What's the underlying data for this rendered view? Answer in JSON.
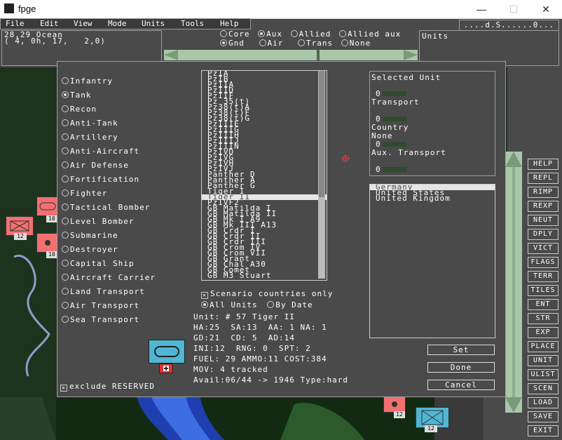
{
  "window": {
    "title": "fpge",
    "min": "—",
    "max": "☐",
    "close": "✕"
  },
  "menu": [
    "File",
    "Edit",
    "View",
    "Mode",
    "Units",
    "Tools",
    "Help"
  ],
  "status_right": "....d.S......0...",
  "hex_info": {
    "line1": "28,29 Ocean",
    "line2": "( 4, 0h, 17,   2,0)"
  },
  "filters_row1": [
    {
      "label": "Core",
      "checked": false
    },
    {
      "label": "Aux",
      "checked": true
    },
    {
      "label": "Allied",
      "checked": false
    },
    {
      "label": "Allied aux",
      "checked": false
    }
  ],
  "filters_row2": [
    {
      "label": "Gnd",
      "checked": true
    },
    {
      "label": "Air",
      "checked": false
    },
    {
      "label": "Trans",
      "checked": false
    },
    {
      "label": "None",
      "checked": false
    }
  ],
  "units_panel_label": "Units",
  "unit_types": [
    {
      "label": "Infantry",
      "selected": false
    },
    {
      "label": "Tank",
      "selected": true
    },
    {
      "label": "Recon",
      "selected": false
    },
    {
      "label": "Anti-Tank",
      "selected": false
    },
    {
      "label": "Artillery",
      "selected": false
    },
    {
      "label": "Anti-Aircraft",
      "selected": false
    },
    {
      "label": "Air Defense",
      "selected": false
    },
    {
      "label": "Fortification",
      "selected": false
    },
    {
      "label": "Fighter",
      "selected": false
    },
    {
      "label": "Tactical Bomber",
      "selected": false
    },
    {
      "label": "Level Bomber",
      "selected": false
    },
    {
      "label": "Submarine",
      "selected": false
    },
    {
      "label": "Destroyer",
      "selected": false
    },
    {
      "label": "Capital Ship",
      "selected": false
    },
    {
      "label": "Aircraft Carrier",
      "selected": false
    },
    {
      "label": "Land Transport",
      "selected": false
    },
    {
      "label": "Air Transport",
      "selected": false
    },
    {
      "label": "Sea Transport",
      "selected": false
    }
  ],
  "unit_list": [
    "PzIA",
    "PzIB",
    "PzIIA",
    "PzIID",
    "PzIIF",
    "Pz 35(t)",
    "Pz38(t)A",
    "Pz38(t)F",
    "Pz38(t)G",
    "PzIIIE",
    "PzIIIG",
    "PzIIIH",
    "PzIIIJ",
    "PzIIIN",
    "PzIVD",
    "PzIVG",
    "PzIVH",
    "PzIVJ",
    "Panther D",
    "Panther A",
    "Panther G",
    "Tiger I",
    "Tiger II",
    "PzIVF2",
    "GB Matilda I",
    "GB Matilda II",
    "GB Mk I A9",
    "GB Mk III A13",
    "GB Crdr I",
    "GB Crdr II",
    "GB Crdr III",
    "GB Crom IV",
    "GB Crom VII",
    "GB Grant",
    "GB Chal A30",
    "GB Comet",
    "GB M3 Stuart"
  ],
  "unit_list_selected": 22,
  "scenario_only": {
    "label": "Scenario countries only",
    "checked": true
  },
  "date_filter": [
    {
      "label": "All Units",
      "checked": true
    },
    {
      "label": "By Date",
      "checked": false
    }
  ],
  "unit_info": [
    "Unit: # 57 Tiger II",
    "HA:25  SA:13  AA: 1 NA: 1",
    "GD:21  CD: 5  AD:14",
    "INI:12  RNG: 0  SPT: 2",
    "FUEL: 29 AMMO:11 COST:384",
    "MOV: 4 tracked",
    "Avail:06/44 -> 1946 Type:hard"
  ],
  "exclude_reserved": {
    "label": "exclude RESERVED",
    "checked": true
  },
  "selected_unit": {
    "title": "Selected Unit",
    "unit_value": "0",
    "transport_label": "Transport",
    "transport_value": "0",
    "country_label": "Country",
    "country_name": "None",
    "country_value": "0",
    "aux_label": "Aux. Transport",
    "aux_value": "0"
  },
  "countries": [
    "Germany",
    "United States",
    "United Kingdom"
  ],
  "country_selected": 0,
  "dialog_buttons": {
    "set": "Set",
    "done": "Done",
    "cancel": "Cancel"
  },
  "sidebar_buttons": [
    "HELP",
    "REPL",
    "RIMP",
    "REXP",
    "NEUT",
    "DPLY",
    "VICT",
    "FLAGS",
    "TERR",
    "TILES",
    "ENT",
    "STR",
    "EXP",
    "PLACE",
    "UNIT",
    "ULIST",
    "SCEN",
    "LOAD",
    "SAVE",
    "EXIT"
  ],
  "map_unit_labels": [
    "10",
    "12",
    "10",
    "12",
    "12"
  ],
  "colors": {
    "background": "#4a4a4a",
    "text": "#ffffff",
    "scroll_green": "#a9c7a9",
    "unit_red": "#f27070",
    "unit_blue": "#4fb7d4"
  }
}
